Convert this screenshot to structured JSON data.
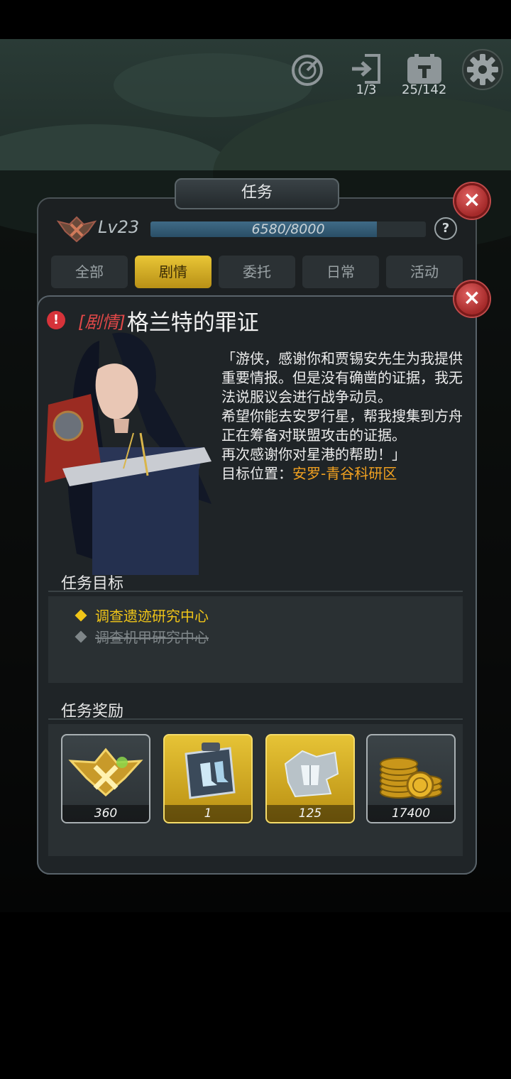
{
  "top_bar": {
    "icons": [
      "radar-icon",
      "exit-door-icon",
      "calendar-icon",
      "gear-icon"
    ],
    "exit_count": "1/3",
    "calendar_count": "25/142"
  },
  "panel": {
    "title": "任务",
    "level": "Lv23",
    "xp_text": "6580/8000",
    "xp_fraction": 0.8225,
    "help_label": "?",
    "tabs": [
      "全部",
      "剧情",
      "委托",
      "日常",
      "活动"
    ],
    "active_tab": "剧情"
  },
  "quest": {
    "tag": "[剧情]",
    "name": "格兰特的罪证",
    "description": [
      "「游侠，感谢你和贾锡安先生为我提供重要情报。但是没有确凿的证据，我无法说服议会进行战争动员。",
      "希望你能去安罗行星，帮我搜集到方舟正在筹备对联盟攻击的证据。",
      "再次感谢你对星港的帮助！」"
    ],
    "target_label": "目标位置：",
    "target_location": "安罗-青谷科研区",
    "objectives_title": "任务目标",
    "objectives": [
      {
        "text": "调查遗迹研究中心",
        "done": false
      },
      {
        "text": "调查机甲研究中心",
        "done": true
      }
    ],
    "rewards_title": "任务奖励",
    "rewards": [
      {
        "icon": "rank-emblem-icon",
        "qty": "360"
      },
      {
        "icon": "armor-boots-blueprint-icon",
        "qty": "1"
      },
      {
        "icon": "armor-chest-fragment-icon",
        "qty": "125"
      },
      {
        "icon": "gold-coins-icon",
        "qty": "17400"
      }
    ]
  },
  "colors": {
    "accent_gold": "#e9c636",
    "tag_red": "#e04848",
    "location_orange": "#f0a020",
    "objective_active": "#f0c518",
    "close_red": "#c24a4a"
  }
}
